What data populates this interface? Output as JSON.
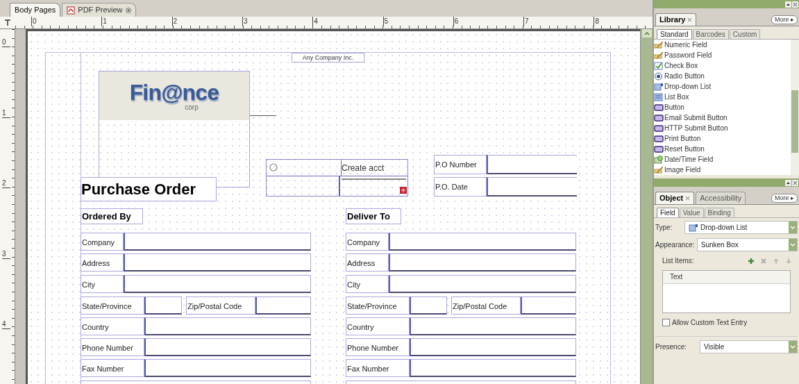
{
  "tabs": [
    {
      "label": "Body Pages",
      "selected": true,
      "kind": "page"
    },
    {
      "label": "PDF Preview",
      "selected": false,
      "kind": "preview"
    }
  ],
  "ruler": {
    "h_labels": [
      "0",
      "1",
      "2",
      "3",
      "4",
      "5",
      "6",
      "7",
      "8"
    ],
    "v_labels": [
      "0",
      "1",
      "2",
      "3",
      "4"
    ]
  },
  "canvas": {
    "header_text": "Any Company Inc.",
    "logo": {
      "name": "Fin@nce",
      "tagline": "corp"
    },
    "title": "Purchase Order",
    "radio_group": {
      "label": "Create acct",
      "selected": false
    },
    "po_fields": [
      "P.O Number",
      "P.O. Date"
    ],
    "sections": [
      {
        "heading": "Ordered By",
        "rows": [
          {
            "kind": "field",
            "labels": [
              "Company"
            ]
          },
          {
            "kind": "field",
            "labels": [
              "Address"
            ]
          },
          {
            "kind": "field",
            "labels": [
              "City"
            ]
          },
          {
            "kind": "pair",
            "labels": [
              "State/Province",
              "Zip/Postal Code"
            ]
          },
          {
            "kind": "wide-field",
            "labels": [
              "Country"
            ]
          },
          {
            "kind": "wide-field",
            "labels": [
              "Phone Number"
            ]
          },
          {
            "kind": "wide-field",
            "labels": [
              "Fax Number"
            ]
          }
        ]
      },
      {
        "heading": "Deliver To",
        "rows": [
          {
            "kind": "field",
            "labels": [
              "Company"
            ]
          },
          {
            "kind": "field",
            "labels": [
              "Address"
            ]
          },
          {
            "kind": "field",
            "labels": [
              "City"
            ]
          },
          {
            "kind": "pair",
            "labels": [
              "State/Province",
              "Zip/Postal Code"
            ]
          },
          {
            "kind": "wide-field",
            "labels": [
              "Country"
            ]
          },
          {
            "kind": "wide-field",
            "labels": [
              "Phone Number"
            ]
          },
          {
            "kind": "wide-field",
            "labels": [
              "Fax Number"
            ]
          }
        ]
      }
    ]
  },
  "library": {
    "title": "Library",
    "more": "More ▸",
    "subtabs": [
      {
        "label": "Standard",
        "selected": true
      },
      {
        "label": "Barcodes",
        "selected": false
      },
      {
        "label": "Custom",
        "selected": false
      }
    ],
    "items": [
      {
        "label": "Numeric Field",
        "kind": "field"
      },
      {
        "label": "Password Field",
        "kind": "field"
      },
      {
        "label": "Check Box",
        "kind": "check"
      },
      {
        "label": "Radio Button",
        "kind": "radio"
      },
      {
        "label": "Drop-down List",
        "kind": "dropdown"
      },
      {
        "label": "List Box",
        "kind": "listbox"
      },
      {
        "label": "Button",
        "kind": "button"
      },
      {
        "label": "Email Submit Button",
        "kind": "button"
      },
      {
        "label": "HTTP Submit Button",
        "kind": "button"
      },
      {
        "label": "Print Button",
        "kind": "button"
      },
      {
        "label": "Reset Button",
        "kind": "button"
      },
      {
        "label": "Date/Time Field",
        "kind": "datetime"
      },
      {
        "label": "Image Field",
        "kind": "field"
      }
    ]
  },
  "object": {
    "tabs": [
      {
        "label": "Object",
        "selected": true
      },
      {
        "label": "Accessibility",
        "selected": false
      }
    ],
    "more": "More ▸",
    "subtabs": [
      {
        "label": "Field",
        "selected": true
      },
      {
        "label": "Value",
        "selected": false
      },
      {
        "label": "Binding",
        "selected": false
      }
    ],
    "type": {
      "label": "Type:",
      "value": "Drop-down List"
    },
    "appearance": {
      "label": "Appearance:",
      "value": "Sunken Box"
    },
    "list_items": {
      "label": "List Items:",
      "column": "Text"
    },
    "custom_entry": {
      "label": "Allow Custom Text Entry",
      "checked": false
    },
    "presence": {
      "label": "Presence:",
      "value": "Visible"
    }
  }
}
